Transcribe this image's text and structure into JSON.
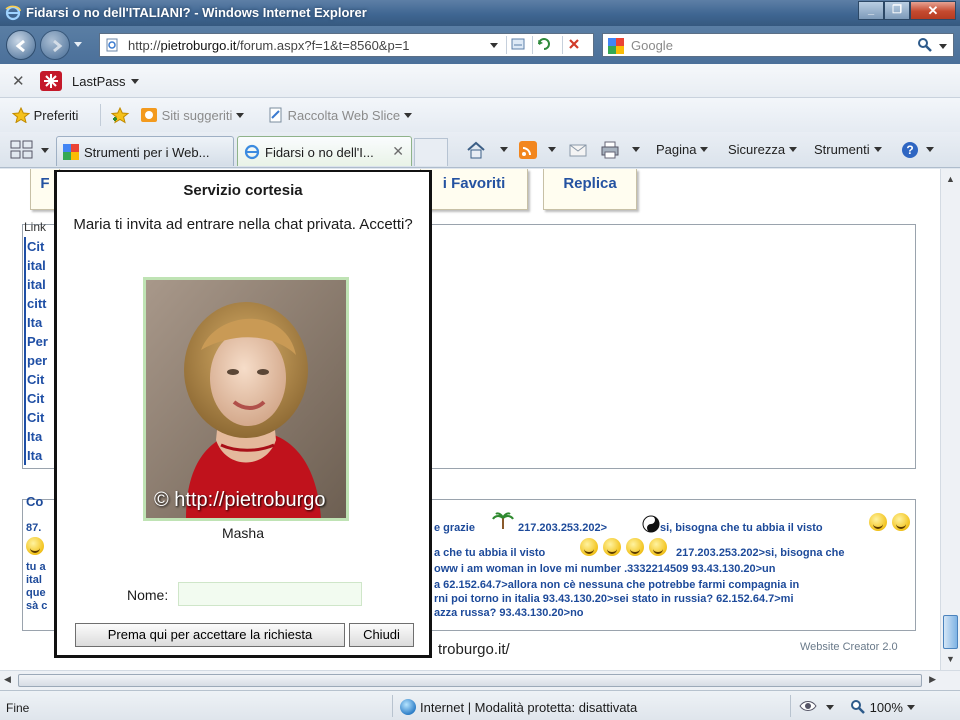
{
  "window": {
    "title": "Fidarsi o no dell'ITALIANI? - Windows Internet Explorer"
  },
  "address": {
    "url_prefix": "http://",
    "url_domain": "pietroburgo.it",
    "url_path": "/forum.aspx?f=1&t=8560&p=1"
  },
  "search": {
    "placeholder": "Google"
  },
  "lastpass": {
    "label": "LastPass"
  },
  "favorites": {
    "preferiti": "Preferiti",
    "siti_suggeriti": "Siti suggeriti",
    "raccolta": "Raccolta Web Slice"
  },
  "tabs": [
    {
      "label": "Strumenti per i Web..."
    },
    {
      "label": "Fidarsi o no dell'I..."
    }
  ],
  "commands": {
    "pagina": "Pagina",
    "sicurezza": "Sicurezza",
    "strumenti": "Strumenti"
  },
  "page": {
    "buttons": {
      "favoriti": "i Favoriti",
      "replica": "Replica",
      "left_letter": "F"
    },
    "links_label": "Link",
    "links": [
      "Cit",
      "ital",
      "ital",
      "citt",
      "Ita",
      "Per",
      "per",
      "Cit",
      "Cit",
      "Cit",
      "Ita",
      "Ita"
    ],
    "comment_label": "Co",
    "row1_prefix": "87.",
    "chat_lines": [
      "e grazie",
      "217.203.253.202>",
      "si, bisogna che tu abbia il visto",
      "a che tu abbia il visto",
      "217.203.253.202>si, bisogna che",
      "oww i am woman in love mi number .3332214509 93.43.130.20>un",
      "a 62.152.64.7>allora non cè nessuna che potrebbe farmi compagnia in",
      "rni poi torno in italia 93.43.130.20>sei stato in russia? 62.152.64.7>mi",
      "azza russa? 93.43.130.20>no"
    ],
    "left_frag": [
      "tu a",
      "ital",
      "que",
      "sà c"
    ],
    "footer_link": "troburgo.it/",
    "website_creator": "Website Creator 2.0"
  },
  "modal": {
    "title": "Servizio cortesia",
    "message": "Maria ti invita ad entrare nella chat privata. Accetti?",
    "photo_watermark": "© http://pietroburgo",
    "person_name": "Masha",
    "name_label": "Nome:",
    "name_value": "",
    "accept_button": "Prema qui per accettare la richiesta",
    "close_button": "Chiudi"
  },
  "status": {
    "left": "Fine",
    "zone": "Internet | Modalità protetta: disattivata",
    "zoom": "100%"
  }
}
